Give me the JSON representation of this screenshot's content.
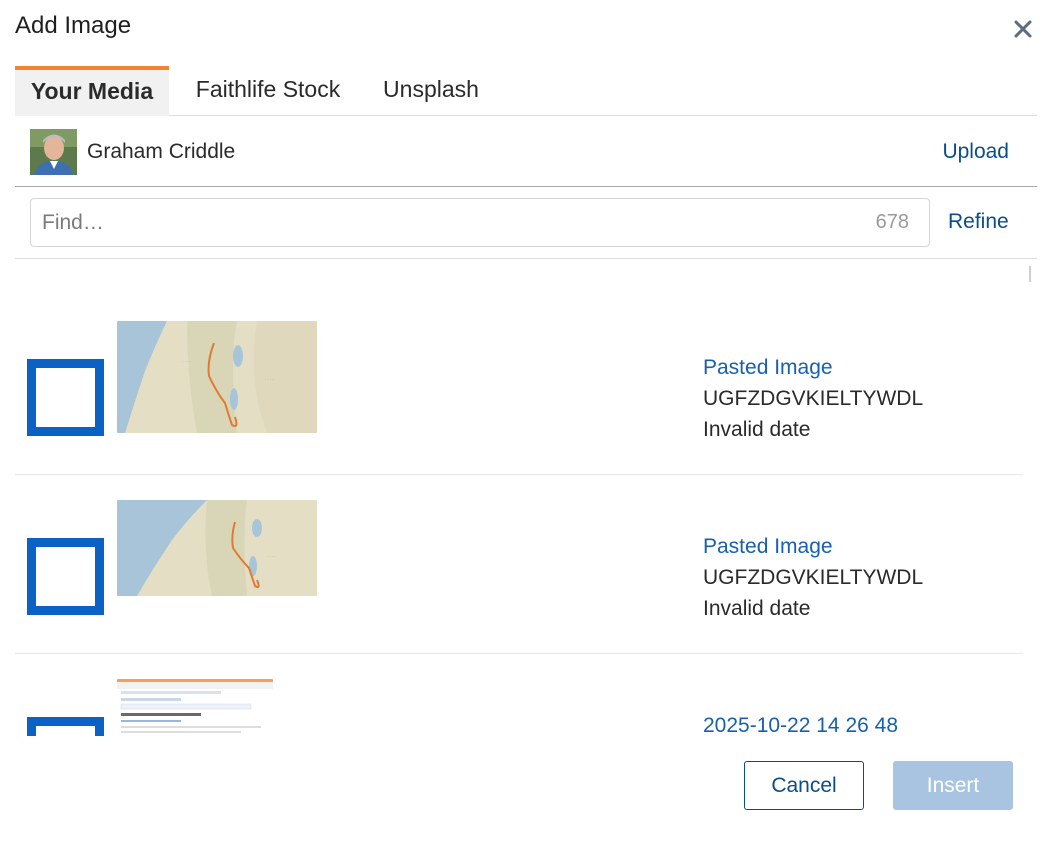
{
  "dialog": {
    "title": "Add Image",
    "close_icon": "close-icon"
  },
  "tabs": [
    {
      "label": "Your Media",
      "active": true
    },
    {
      "label": "Faithlife Stock",
      "active": false
    },
    {
      "label": "Unsplash",
      "active": false
    }
  ],
  "account": {
    "name": "Graham Criddle",
    "upload_label": "Upload"
  },
  "search": {
    "placeholder": "Find…",
    "value": "",
    "count": "678",
    "refine_label": "Refine"
  },
  "items": [
    {
      "title": "Pasted Image",
      "code": "UGFZDGVKIELTYWDL",
      "date": "Invalid date",
      "checked": false,
      "thumbnail": "map-thumbnail"
    },
    {
      "title": "Pasted Image",
      "code": "UGFZDGVKIELTYWDL",
      "date": "Invalid date",
      "checked": false,
      "thumbnail": "map-thumbnail"
    },
    {
      "title": "2025-10-22 14 26 48",
      "code": "",
      "date": "",
      "checked": false,
      "thumbnail": "screenshot-thumbnail"
    }
  ],
  "footer": {
    "cancel_label": "Cancel",
    "insert_label": "Insert",
    "insert_enabled": false
  },
  "colors": {
    "accent_tab": "#f58233",
    "link": "#0b4d8a",
    "checkbox": "#0b62c4",
    "insert_disabled": "#a9c4e0"
  }
}
